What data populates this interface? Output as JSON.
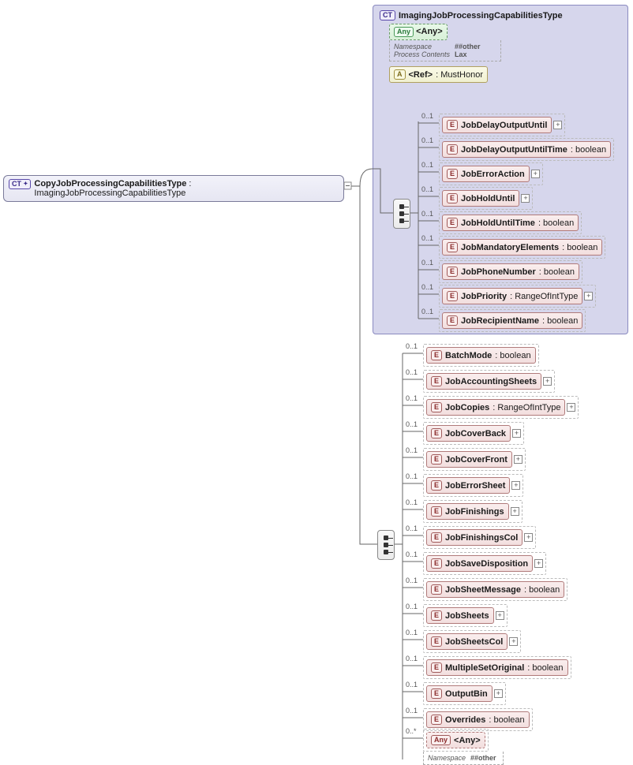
{
  "root": {
    "badge": "CT",
    "name": "CopyJobProcessingCapabilitiesType",
    "base": "ImagingJobProcessingCapabilitiesType"
  },
  "supertype": {
    "badge": "CT",
    "name": "ImagingJobProcessingCapabilitiesType"
  },
  "any": {
    "badge": "Any",
    "label": "<Any>",
    "k1": "Namespace",
    "v1": "##other",
    "k2": "Process Contents",
    "v2": "Lax"
  },
  "ref": {
    "badge": "A",
    "label": "<Ref>",
    "target": ": MustHonor"
  },
  "card01": "0..1",
  "cardAny": "0..*",
  "eBadge": "E",
  "anyBadge": "Any",
  "superElems": [
    {
      "name": "JobDelayOutputUntil",
      "type": "",
      "exp": true
    },
    {
      "name": "JobDelayOutputUntilTime",
      "type": " : boolean",
      "exp": false
    },
    {
      "name": "JobErrorAction",
      "type": "",
      "exp": true
    },
    {
      "name": "JobHoldUntil",
      "type": "",
      "exp": true
    },
    {
      "name": "JobHoldUntilTime",
      "type": " : boolean",
      "exp": false
    },
    {
      "name": "JobMandatoryElements",
      "type": " : boolean",
      "exp": false
    },
    {
      "name": "JobPhoneNumber",
      "type": " : boolean",
      "exp": false
    },
    {
      "name": "JobPriority",
      "type": " : RangeOfIntType",
      "exp": true
    },
    {
      "name": "JobRecipientName",
      "type": " : boolean",
      "exp": false
    }
  ],
  "extElems": [
    {
      "name": "BatchMode",
      "type": " : boolean",
      "exp": false
    },
    {
      "name": "JobAccountingSheets",
      "type": "",
      "exp": true
    },
    {
      "name": "JobCopies",
      "type": " : RangeOfIntType",
      "exp": true
    },
    {
      "name": "JobCoverBack",
      "type": "",
      "exp": true
    },
    {
      "name": "JobCoverFront",
      "type": "",
      "exp": true
    },
    {
      "name": "JobErrorSheet",
      "type": "",
      "exp": true
    },
    {
      "name": "JobFinishings",
      "type": "",
      "exp": true
    },
    {
      "name": "JobFinishingsCol",
      "type": "",
      "exp": true
    },
    {
      "name": "JobSaveDisposition",
      "type": "",
      "exp": true
    },
    {
      "name": "JobSheetMessage",
      "type": " : boolean",
      "exp": false
    },
    {
      "name": "JobSheets",
      "type": "",
      "exp": true
    },
    {
      "name": "JobSheetsCol",
      "type": "",
      "exp": true
    },
    {
      "name": "MultipleSetOriginal",
      "type": " : boolean",
      "exp": false
    },
    {
      "name": "OutputBin",
      "type": "",
      "exp": true
    },
    {
      "name": "Overrides",
      "type": " : boolean",
      "exp": false
    }
  ],
  "extAny": {
    "label": "<Any>",
    "k1": "Namespace",
    "v1": "##other"
  }
}
